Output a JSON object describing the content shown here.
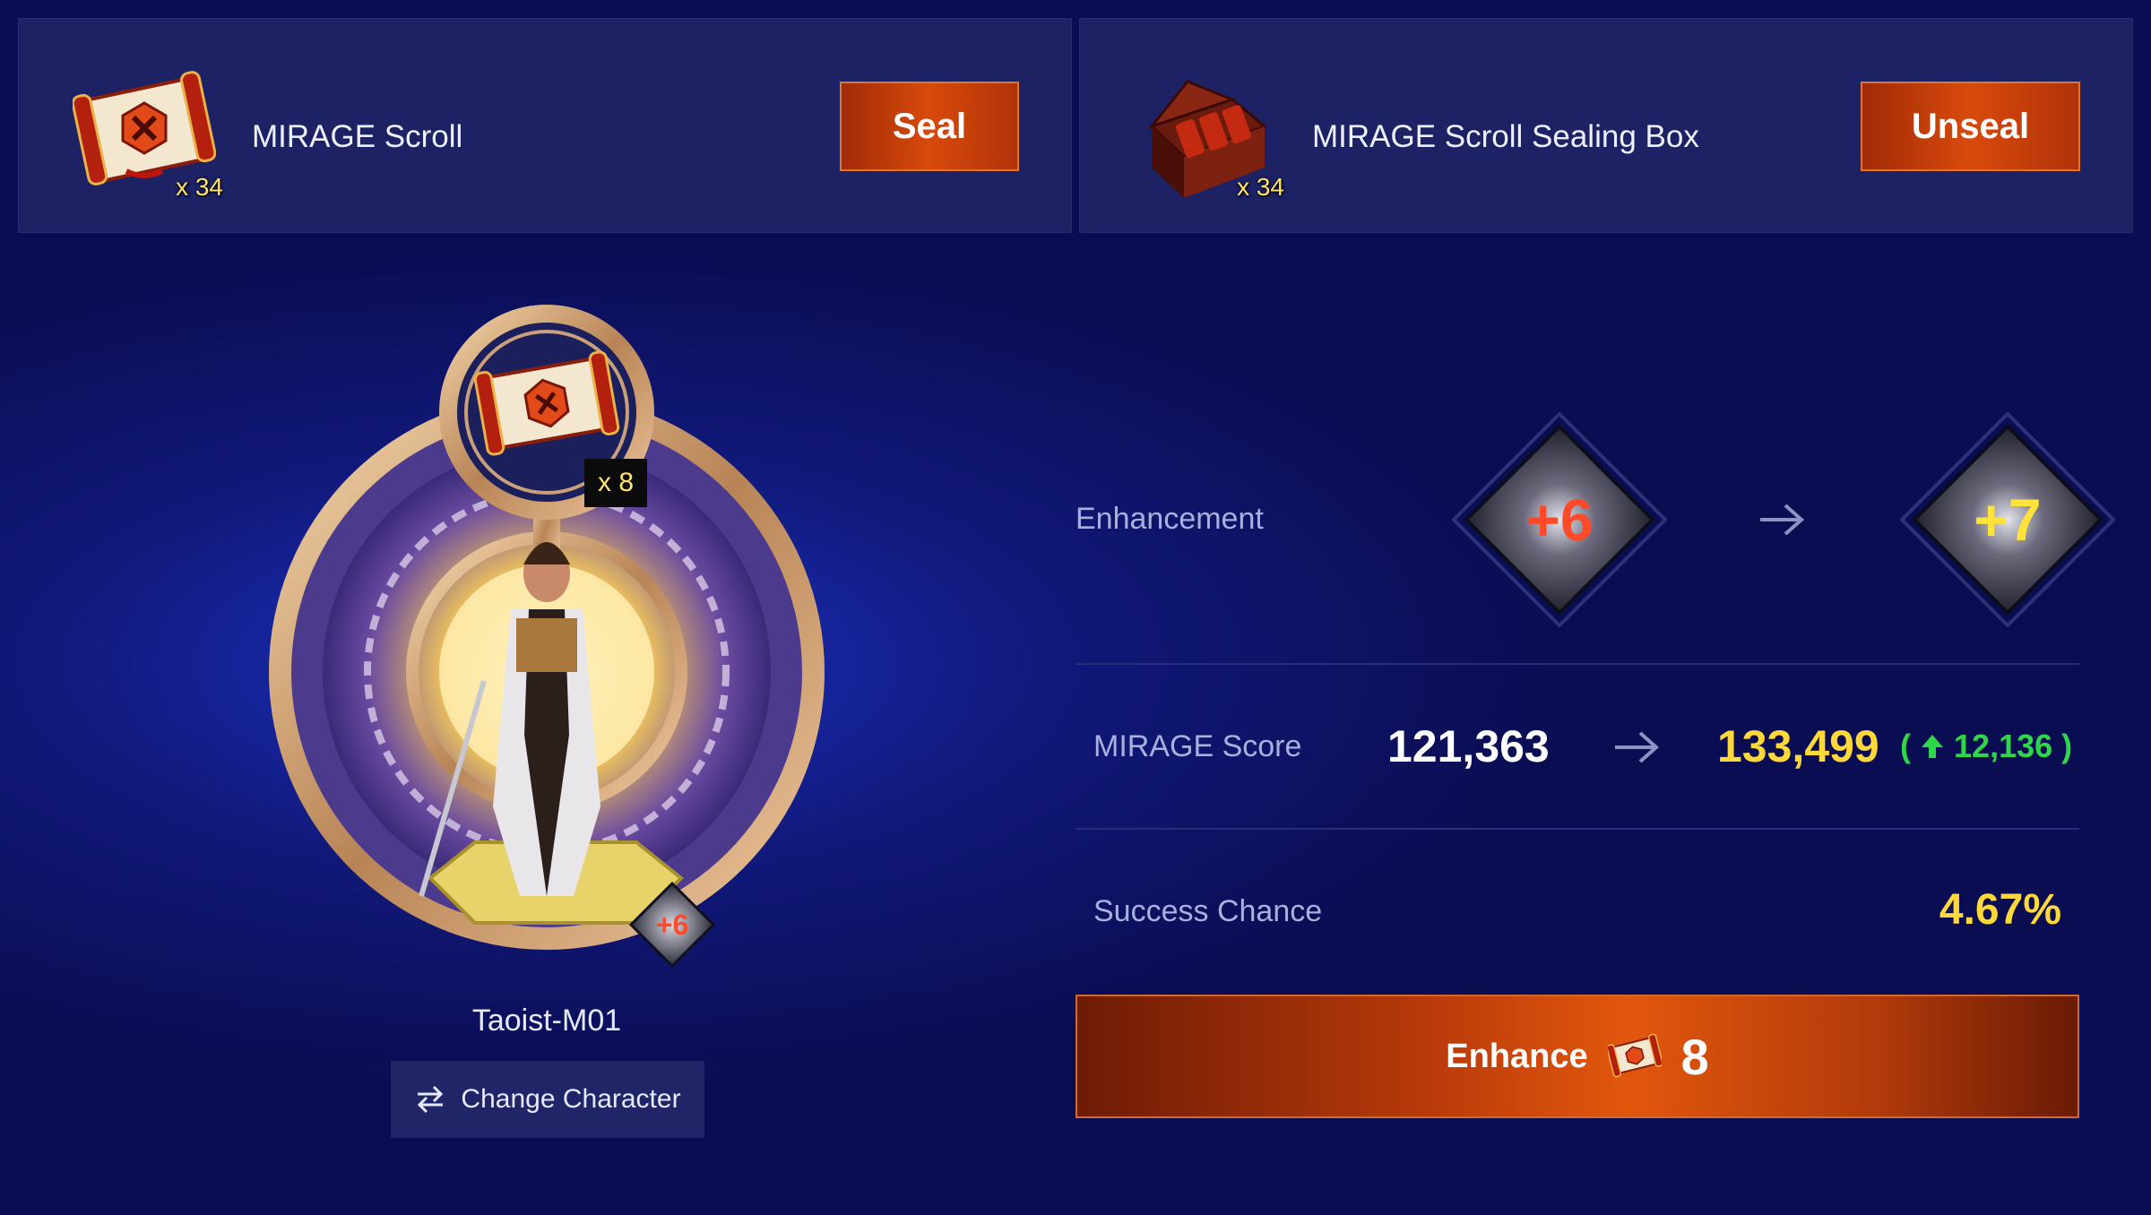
{
  "top": {
    "left": {
      "name": "MIRAGE Scroll",
      "qty": "x 34",
      "button": "Seal"
    },
    "right": {
      "name": "MIRAGE Scroll Sealing Box",
      "qty": "x 34",
      "button": "Unseal"
    }
  },
  "character": {
    "scroll_qty": "x 8",
    "level_badge": "+6",
    "name": "Taoist-M01",
    "change_button": "Change Character"
  },
  "stats": {
    "enhancement_label": "Enhancement",
    "current_level": "+6",
    "next_level": "+7",
    "score_label": "MIRAGE Score",
    "score_current": "121,363",
    "score_new": "133,499",
    "score_increase": "12,136",
    "chance_label": "Success Chance",
    "chance_value": "4.67%"
  },
  "enhance": {
    "label": "Enhance",
    "cost": "8"
  },
  "colors": {
    "background": "#0a0d52",
    "panel": "#1d2264",
    "accent_orange": "#d84a0b",
    "highlight_yellow": "#ffd93a",
    "increase_green": "#2fd64a",
    "level_red": "#ff4a2a"
  }
}
